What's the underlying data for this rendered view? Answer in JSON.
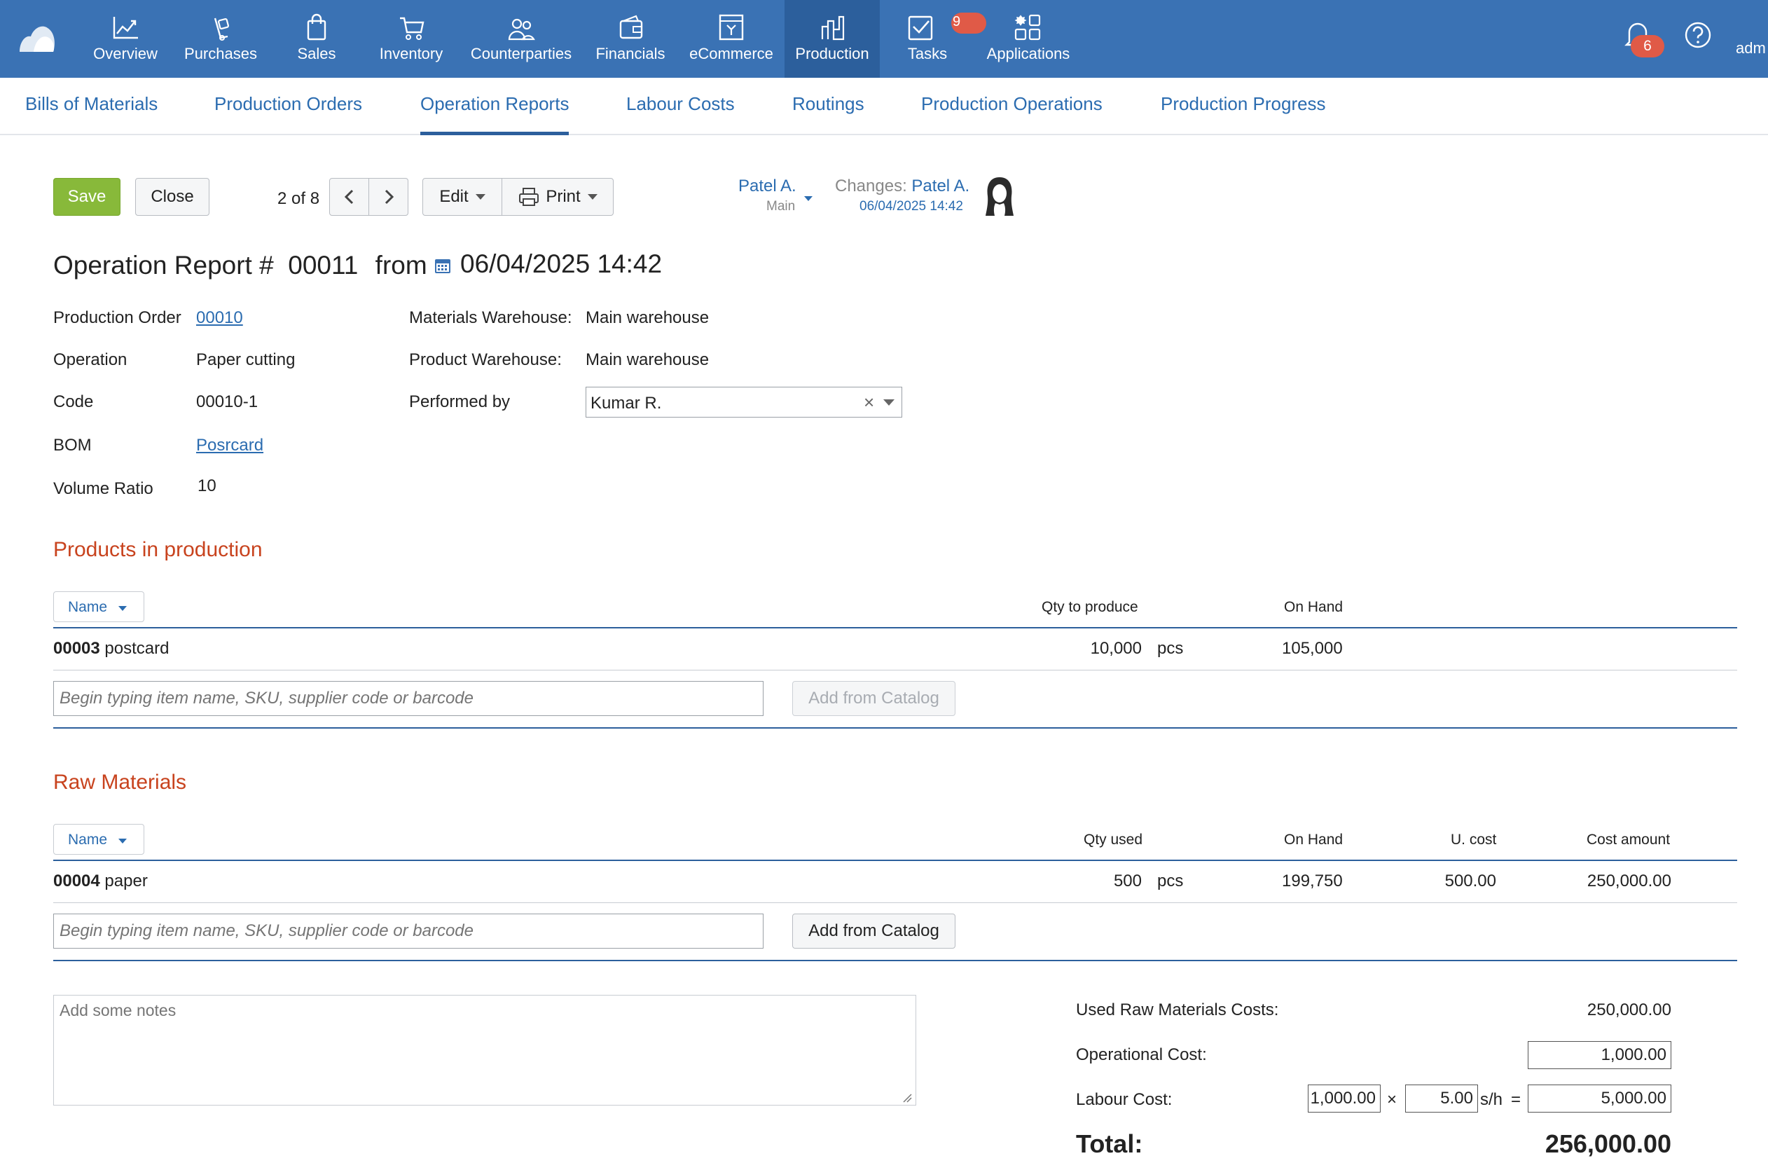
{
  "topnav": {
    "items": [
      {
        "label": "Overview",
        "icon": "chart-line-icon"
      },
      {
        "label": "Purchases",
        "icon": "hand-bag-icon"
      },
      {
        "label": "Sales",
        "icon": "shopping-bag-icon"
      },
      {
        "label": "Inventory",
        "icon": "cart-icon"
      },
      {
        "label": "Counterparties",
        "icon": "people-icon"
      },
      {
        "label": "Financials",
        "icon": "wallet-icon"
      },
      {
        "label": "eCommerce",
        "icon": "storefront-icon"
      },
      {
        "label": "Production",
        "icon": "factory-icon"
      },
      {
        "label": "Tasks",
        "icon": "checkbox-icon"
      },
      {
        "label": "Applications",
        "icon": "apps-grid-icon"
      }
    ],
    "tasks_count": "9",
    "notifications_count": "6",
    "user_label": "adm",
    "colors": {
      "bar": "#3a72b4",
      "active": "#2c5f9c",
      "badge": "#e05a47"
    }
  },
  "subnav": {
    "tabs": [
      "Bills of Materials",
      "Production Orders",
      "Operation Reports",
      "Labour Costs",
      "Routings",
      "Production Operations",
      "Production Progress"
    ],
    "active": "Operation Reports"
  },
  "toolbar": {
    "save": "Save",
    "close": "Close",
    "pager": "2 of 8",
    "edit": "Edit",
    "print": "Print",
    "owner": "Patel A.",
    "owner_sub": "Main",
    "changes_label": "Changes:",
    "changes_user": "Patel A.",
    "changes_date": "06/04/2025 14:42"
  },
  "header": {
    "title": "Operation Report #  00011",
    "from": "from",
    "date": "06/04/2025 14:42"
  },
  "fields": {
    "production_order_label": "Production Order",
    "production_order": "00010",
    "operation_label": "Operation",
    "operation": "Paper cutting",
    "code_label": "Code",
    "code": "00010-1",
    "bom_label": "BOM",
    "bom": "Posrcard",
    "volume_ratio_label": "Volume Ratio",
    "volume_ratio": "10",
    "materials_wh_label": "Materials Warehouse:",
    "materials_wh": "Main warehouse",
    "product_wh_label": "Product Warehouse:",
    "product_wh": "Main warehouse",
    "performed_by_label": "Performed by",
    "performed_by": "Kumar R."
  },
  "products": {
    "title": "Products in production",
    "name_btn": "Name",
    "headers": {
      "qty": "Qty to produce",
      "on_hand": "On Hand"
    },
    "rows": [
      {
        "code": "00003",
        "name": "postcard",
        "qty": "10,000",
        "unit": "pcs",
        "on_hand": "105,000"
      }
    ],
    "input_placeholder": "Begin typing item name, SKU, supplier code or barcode",
    "catalog": "Add from Catalog"
  },
  "materials": {
    "title": "Raw Materials",
    "name_btn": "Name",
    "headers": {
      "qty": "Qty used",
      "on_hand": "On Hand",
      "ucost": "U. cost",
      "amount": "Cost amount"
    },
    "rows": [
      {
        "code": "00004",
        "name": "paper",
        "qty": "500",
        "unit": "pcs",
        "on_hand": "199,750",
        "ucost": "500.00",
        "amount": "250,000.00"
      }
    ],
    "input_placeholder": "Begin typing item name, SKU, supplier code or barcode",
    "catalog": "Add from Catalog"
  },
  "notes_placeholder": "Add some notes",
  "costs": {
    "raw_label": "Used Raw Materials Costs:",
    "raw_value": "250,000.00",
    "op_label": "Operational Cost:",
    "op_value": "1,000.00",
    "labour_label": "Labour Cost:",
    "labour_rate": "1,000.00",
    "times": "×",
    "labour_hours": "5.00",
    "unit": "s/h",
    "equals": "=",
    "labour_value": "5,000.00",
    "total_label": "Total:",
    "total_value": "256,000.00"
  }
}
